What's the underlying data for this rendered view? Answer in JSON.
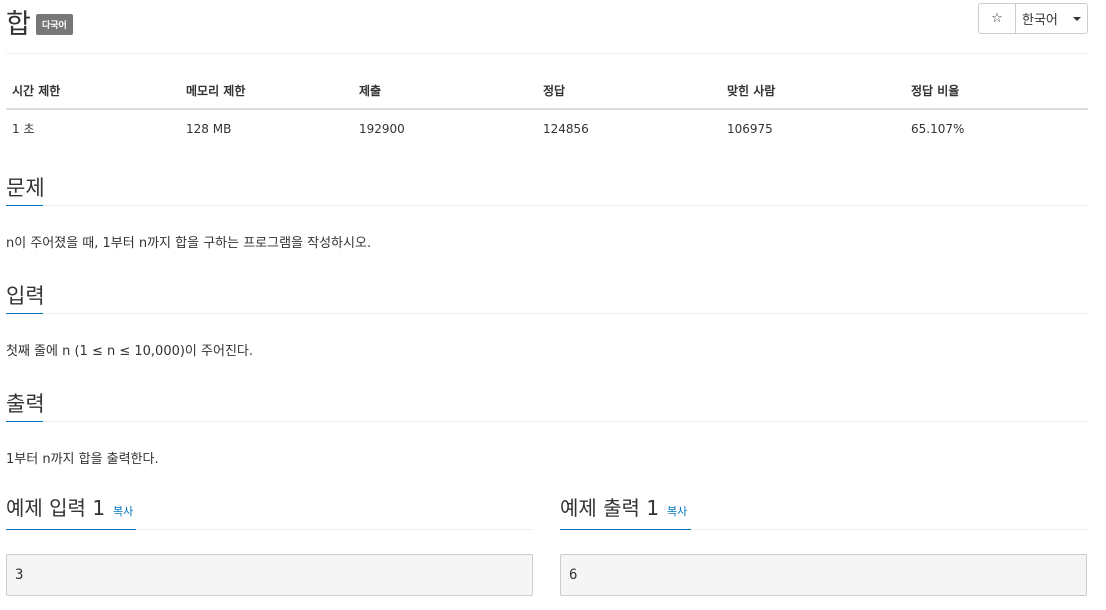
{
  "problem": {
    "title": "합",
    "badge": "다국어"
  },
  "header_controls": {
    "star_glyph": "☆",
    "language": "한국어"
  },
  "info_table": {
    "headers": [
      "시간 제한",
      "메모리 제한",
      "제출",
      "정답",
      "맞힌 사람",
      "정답 비율"
    ],
    "values": [
      "1 초",
      "128 MB",
      "192900",
      "124856",
      "106975",
      "65.107%"
    ]
  },
  "sections": {
    "problem": {
      "heading": "문제",
      "body": "n이 주어졌을 때, 1부터 n까지 합을 구하는 프로그램을 작성하시오."
    },
    "input": {
      "heading": "입력",
      "body": "첫째 줄에 n (1 ≤ n ≤ 10,000)이 주어진다."
    },
    "output": {
      "heading": "출력",
      "body": "1부터 n까지 합을 출력한다."
    }
  },
  "samples": {
    "input": {
      "heading": "예제 입력 1",
      "copy": "복사",
      "value": "3"
    },
    "output": {
      "heading": "예제 출력 1",
      "copy": "복사",
      "value": "6"
    }
  },
  "colors": {
    "accent": "#0076c0",
    "badge_bg": "#777777"
  }
}
